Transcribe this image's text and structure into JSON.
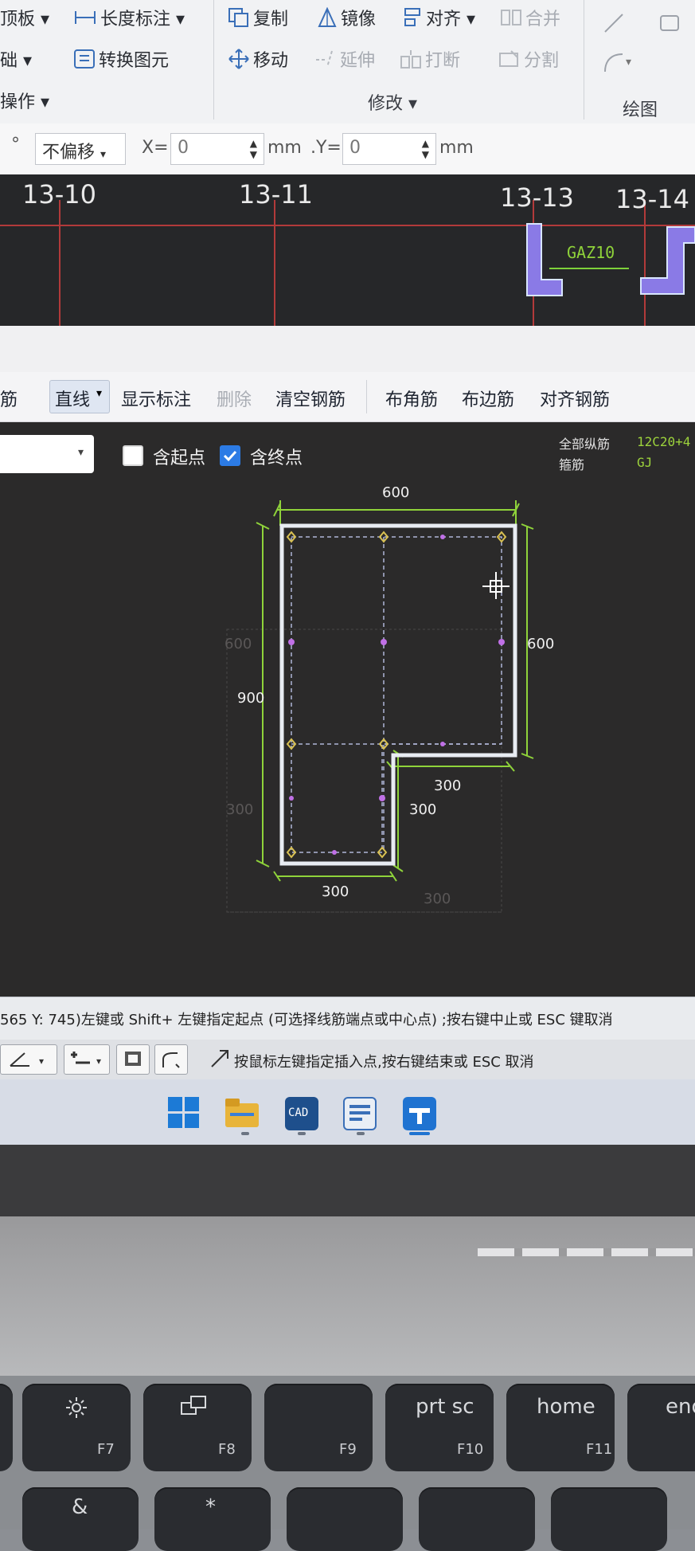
{
  "ribbon": {
    "left_items": [
      "顶板",
      "础",
      "操作"
    ],
    "length_dim": "长度标注",
    "convert": "转换图元",
    "copy": "复制",
    "mirror": "镜像",
    "align": "对齐",
    "merge": "合并",
    "move": "移动",
    "extend": "延伸",
    "break": "打断",
    "split": "分割",
    "modify_group": "修改",
    "draw_group": "绘图"
  },
  "propbar": {
    "degree": "°",
    "offset": "不偏移",
    "x_label": "X=",
    "x_value": "0",
    "y_label": ".Y=",
    "y_value": "0",
    "unit": "mm"
  },
  "axes": [
    "13-10",
    "13-11",
    "13-13",
    "13-14"
  ],
  "column_tag": "GAZ10",
  "dialog": {
    "tools": {
      "stirrup": "筋",
      "line_mode": "直线",
      "show_dim": "显示标注",
      "delete": "删除",
      "clear": "清空钢筋",
      "corner": "布角筋",
      "edge": "布边筋",
      "align": "对齐钢筋"
    },
    "start_point": "含起点",
    "end_point": "含终点",
    "start_checked": false,
    "end_checked": true,
    "legend": {
      "all_rebar": "全部纵筋",
      "all_rebar_value": "12C20+4",
      "stirrup": "箍筋",
      "stirrup_value": "GJ"
    },
    "dims": {
      "top": "600",
      "right": "600",
      "left": "900",
      "inner_h": "300",
      "inner_v": "300",
      "bottom": "300",
      "ghost1": "600",
      "ghost2": "300",
      "ghost3": "300"
    }
  },
  "status": {
    "prompt": "565 Y: 745)左键或 Shift+ 左键指定起点 (可选择线筋端点或中心点) ;按右键中止或 ESC 键取消",
    "insert_hint": "按鼠标左键指定插入点,按右键结束或 ESC 取消"
  },
  "taskbar": [
    "windows-start",
    "file-explorer",
    "cad-app",
    "glodon-app",
    "edu-app"
  ],
  "taskbar_cad_text": "CAD",
  "keyboard": {
    "f7": "F7",
    "f8": "F8",
    "f9": "F9",
    "prtsc": "prt sc",
    "f10": "F10",
    "home": "home",
    "f11": "F11",
    "end": "end",
    "amp": "&",
    "star": "*"
  },
  "colors": {
    "cad_bg": "#2b2a2a",
    "outline": "#e8ecf2",
    "dim_green": "#8fd33a",
    "node_yellow": "#d9c152",
    "node_violet": "#c070e6",
    "checkbox_blue": "#2c7be5"
  }
}
